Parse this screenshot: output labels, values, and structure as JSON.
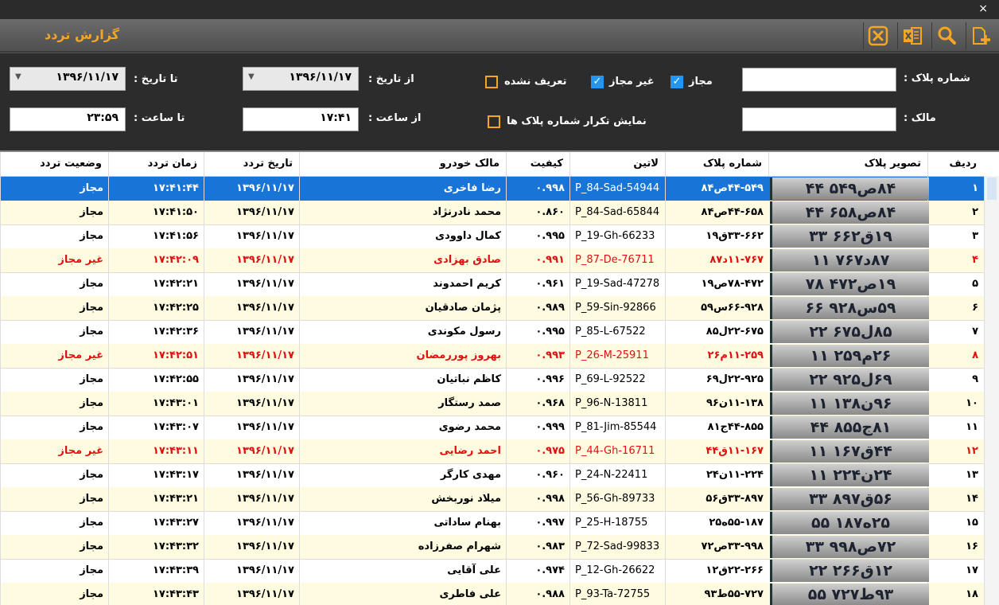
{
  "window": {
    "close_glyph": "×"
  },
  "header": {
    "title": "گزارش تردد"
  },
  "toolbar": {
    "icons": [
      "close-icon",
      "excel-icon",
      "search-icon",
      "add-icon"
    ],
    "accent": "#f5a623"
  },
  "filters": {
    "plate_label": "شماره پلاک :",
    "owner_label": "مالک :",
    "allowed_label": "مجاز",
    "not_allowed_label": "غیر مجاز",
    "undefined_label": "تعریف نشده",
    "repeat_label": "نمایش تکرار شماره پلاک ها",
    "from_date_label": "از تاریخ :",
    "to_date_label": "تا تاریخ :",
    "from_time_label": "از ساعت :",
    "to_time_label": "تا ساعت :",
    "from_date": "۱۳۹۶/۱۱/۱۷",
    "to_date": "۱۳۹۶/۱۱/۱۷",
    "from_time": "۱۷:۴۱",
    "to_time": "۲۳:۵۹",
    "plate_value": "",
    "owner_value": ""
  },
  "table": {
    "headers": [
      "ردیف",
      "تصویر پلاک",
      "شماره پلاک",
      "لاتین",
      "کیفیت",
      "مالک خودرو",
      "تاریخ تردد",
      "زمان تردد",
      "وضعیت تردد"
    ],
    "rows": [
      {
        "row": "۱",
        "plate_img": "۸۴ص۵۴۹ ۴۴",
        "plate": "۴۴-۵۴۹ص۸۴",
        "latin": "P_84-Sad-54944",
        "quality": "۰.۹۹۸",
        "owner": "رضا فاخری",
        "date": "۱۳۹۶/۱۱/۱۷",
        "time": "۱۷:۴۱:۴۴",
        "status": "مجاز"
      },
      {
        "row": "۲",
        "plate_img": "۸۴ص۶۵۸ ۴۴",
        "plate": "۴۴-۶۵۸ص۸۴",
        "latin": "P_84-Sad-65844",
        "quality": "۰.۸۶۰",
        "owner": "محمد نادرنژاد",
        "date": "۱۳۹۶/۱۱/۱۷",
        "time": "۱۷:۴۱:۵۰",
        "status": "مجاز"
      },
      {
        "row": "۳",
        "plate_img": "۱۹ق۶۶۲ ۳۳",
        "plate": "۳۳-۶۶۲ق۱۹",
        "latin": "P_19-Gh-66233",
        "quality": "۰.۹۹۵",
        "owner": "کمال داوودی",
        "date": "۱۳۹۶/۱۱/۱۷",
        "time": "۱۷:۴۱:۵۶",
        "status": "مجاز"
      },
      {
        "row": "۴",
        "plate_img": "۸۷د۷۶۷ ۱۱",
        "plate": "۱۱-۷۶۷د۸۷",
        "latin": "P_87-De-76711",
        "quality": "۰.۹۹۱",
        "owner": "صادق بهزادی",
        "date": "۱۳۹۶/۱۱/۱۷",
        "time": "۱۷:۴۲:۰۹",
        "status": "غیر مجاز"
      },
      {
        "row": "۵",
        "plate_img": "۱۹ص۴۷۲ ۷۸",
        "plate": "۷۸-۴۷۲ص۱۹",
        "latin": "P_19-Sad-47278",
        "quality": "۰.۹۶۱",
        "owner": "کریم احمدوند",
        "date": "۱۳۹۶/۱۱/۱۷",
        "time": "۱۷:۴۲:۲۱",
        "status": "مجاز"
      },
      {
        "row": "۶",
        "plate_img": "۵۹س۹۲۸ ۶۶",
        "plate": "۶۶-۹۲۸س۵۹",
        "latin": "P_59-Sin-92866",
        "quality": "۰.۹۸۹",
        "owner": "پژمان صادقیان",
        "date": "۱۳۹۶/۱۱/۱۷",
        "time": "۱۷:۴۲:۲۵",
        "status": "مجاز"
      },
      {
        "row": "۷",
        "plate_img": "۸۵ل۶۷۵ ۲۲",
        "plate": "۲۲-۶۷۵ل۸۵",
        "latin": "P_85-L-67522",
        "quality": "۰.۹۹۵",
        "owner": "رسول مکوندی",
        "date": "۱۳۹۶/۱۱/۱۷",
        "time": "۱۷:۴۲:۳۶",
        "status": "مجاز"
      },
      {
        "row": "۸",
        "plate_img": "۲۶م۲۵۹ ۱۱",
        "plate": "۱۱-۲۵۹م۲۶",
        "latin": "P_26-M-25911",
        "quality": "۰.۹۹۳",
        "owner": "بهروز پوررمضان",
        "date": "۱۳۹۶/۱۱/۱۷",
        "time": "۱۷:۴۲:۵۱",
        "status": "غیر مجاز"
      },
      {
        "row": "۹",
        "plate_img": "۶۹ل۹۲۵ ۲۲",
        "plate": "۲۲-۹۲۵ل۶۹",
        "latin": "P_69-L-92522",
        "quality": "۰.۹۹۶",
        "owner": "کاظم نباتیان",
        "date": "۱۳۹۶/۱۱/۱۷",
        "time": "۱۷:۴۲:۵۵",
        "status": "مجاز"
      },
      {
        "row": "۱۰",
        "plate_img": "۹۶ن۱۳۸ ۱۱",
        "plate": "۱۱-۱۳۸ن۹۶",
        "latin": "P_96-N-13811",
        "quality": "۰.۹۶۸",
        "owner": "صمد رستگار",
        "date": "۱۳۹۶/۱۱/۱۷",
        "time": "۱۷:۴۳:۰۱",
        "status": "مجاز"
      },
      {
        "row": "۱۱",
        "plate_img": "۸۱ج۸۵۵ ۴۴",
        "plate": "۴۴-۸۵۵ج۸۱",
        "latin": "P_81-Jim-85544",
        "quality": "۰.۹۹۹",
        "owner": "محمد رضوی",
        "date": "۱۳۹۶/۱۱/۱۷",
        "time": "۱۷:۴۳:۰۷",
        "status": "مجاز"
      },
      {
        "row": "۱۲",
        "plate_img": "۴۴ق۱۶۷ ۱۱",
        "plate": "۱۱-۱۶۷ق۴۴",
        "latin": "P_44-Gh-16711",
        "quality": "۰.۹۷۵",
        "owner": "احمد رضایی",
        "date": "۱۳۹۶/۱۱/۱۷",
        "time": "۱۷:۴۳:۱۱",
        "status": "غیر مجاز"
      },
      {
        "row": "۱۳",
        "plate_img": "۲۴ن۲۲۴ ۱۱",
        "plate": "۱۱-۲۲۴ن۲۴",
        "latin": "P_24-N-22411",
        "quality": "۰.۹۶۰",
        "owner": "مهدی کارگر",
        "date": "۱۳۹۶/۱۱/۱۷",
        "time": "۱۷:۴۳:۱۷",
        "status": "مجاز"
      },
      {
        "row": "۱۴",
        "plate_img": "۵۶ق۸۹۷ ۳۳",
        "plate": "۳۳-۸۹۷ق۵۶",
        "latin": "P_56-Gh-89733",
        "quality": "۰.۹۹۸",
        "owner": "میلاد نوربخش",
        "date": "۱۳۹۶/۱۱/۱۷",
        "time": "۱۷:۴۳:۲۱",
        "status": "مجاز"
      },
      {
        "row": "۱۵",
        "plate_img": "۲۵ه۱۸۷ ۵۵",
        "plate": "۵۵-۱۸۷ه۲۵",
        "latin": "P_25-H-18755",
        "quality": "۰.۹۹۷",
        "owner": "بهنام ساداتی",
        "date": "۱۳۹۶/۱۱/۱۷",
        "time": "۱۷:۴۳:۲۷",
        "status": "مجاز"
      },
      {
        "row": "۱۶",
        "plate_img": "۷۲ص۹۹۸ ۳۳",
        "plate": "۳۳-۹۹۸ص۷۲",
        "latin": "P_72-Sad-99833",
        "quality": "۰.۹۸۳",
        "owner": "شهرام صفرزاده",
        "date": "۱۳۹۶/۱۱/۱۷",
        "time": "۱۷:۴۳:۳۲",
        "status": "مجاز"
      },
      {
        "row": "۱۷",
        "plate_img": "۱۲ق۲۶۶ ۲۲",
        "plate": "۲۲-۲۶۶ق۱۲",
        "latin": "P_12-Gh-26622",
        "quality": "۰.۹۷۴",
        "owner": "علی آقایی",
        "date": "۱۳۹۶/۱۱/۱۷",
        "time": "۱۷:۴۳:۳۹",
        "status": "مجاز"
      },
      {
        "row": "۱۸",
        "plate_img": "۹۳ط۷۲۷ ۵۵",
        "plate": "۵۵-۷۲۷ط۹۳",
        "latin": "P_93-Ta-72755",
        "quality": "۰.۹۸۸",
        "owner": "علی فاطری",
        "date": "۱۳۹۶/۱۱/۱۷",
        "time": "۱۷:۴۳:۴۳",
        "status": "مجاز"
      }
    ]
  },
  "colors": {
    "selected_row": "#1874d6",
    "alt_row": "#fffbe0",
    "denied_text": "#e01010",
    "title": "#f5a623"
  }
}
